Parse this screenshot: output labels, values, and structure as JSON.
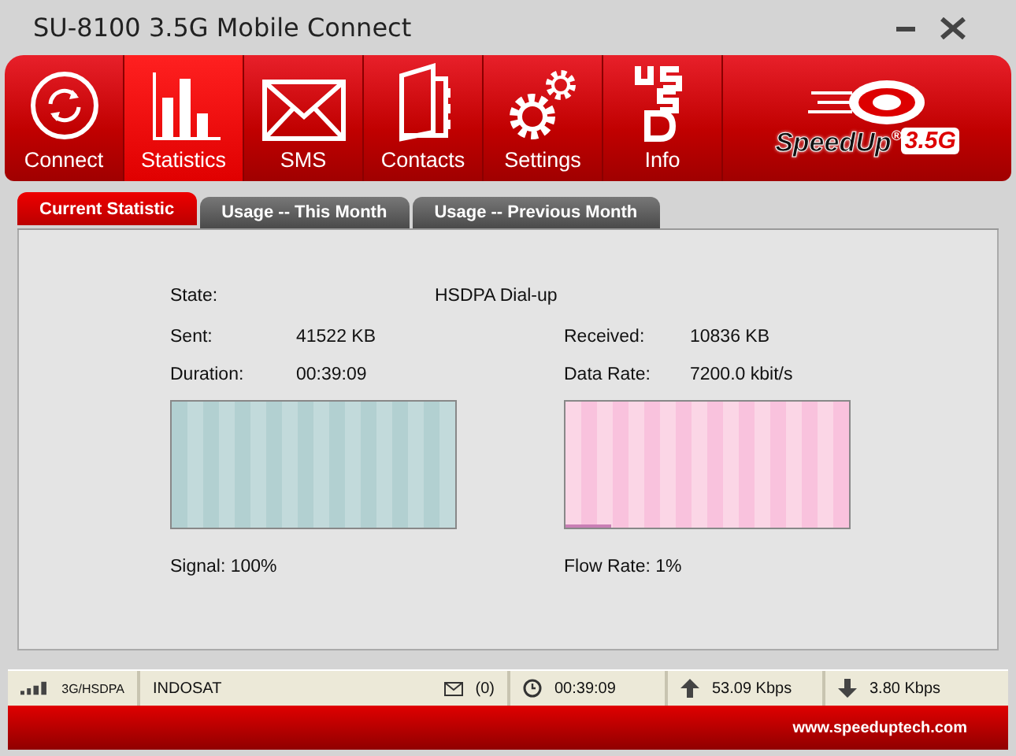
{
  "window": {
    "title": "SU-8100 3.5G Mobile Connect"
  },
  "toolbar": [
    {
      "label": "Connect",
      "kind": "connect",
      "selected": false
    },
    {
      "label": "Statistics",
      "kind": "statistics",
      "selected": true
    },
    {
      "label": "SMS",
      "kind": "sms",
      "selected": false
    },
    {
      "label": "Contacts",
      "kind": "contacts",
      "selected": false
    },
    {
      "label": "Settings",
      "kind": "settings",
      "selected": false
    },
    {
      "label": "Info",
      "kind": "info",
      "selected": false
    }
  ],
  "logo": {
    "name": "SpeedUp",
    "mark": "®",
    "version": "3.5G"
  },
  "tabs": [
    {
      "label": "Current Statistic",
      "selected": true
    },
    {
      "label": "Usage -- This Month",
      "selected": false
    },
    {
      "label": "Usage -- Previous Month",
      "selected": false
    }
  ],
  "stats": {
    "state_label": "State:",
    "state_value": "HSDPA Dial-up",
    "left": [
      {
        "label": "Sent:",
        "value": "41522 KB"
      },
      {
        "label": "Duration:",
        "value": "00:39:09"
      }
    ],
    "right": [
      {
        "label": "Received:",
        "value": "10836 KB"
      },
      {
        "label": "Data Rate:",
        "value": "7200.0 kbit/s"
      }
    ]
  },
  "meters": [
    {
      "kind": "signal",
      "level": 1,
      "caption": "Signal: 100%"
    },
    {
      "kind": "flow",
      "level": 0.16,
      "caption": "Flow Rate: 1%"
    }
  ],
  "status_bar": {
    "network": "3G/HSDPA",
    "operator": "INDOSAT",
    "messages": "(0)",
    "time": "00:39:09",
    "upload": "53.09 Kbps",
    "download": "3.80 Kbps"
  },
  "footer": {
    "url": "www.speeduptech.com"
  }
}
